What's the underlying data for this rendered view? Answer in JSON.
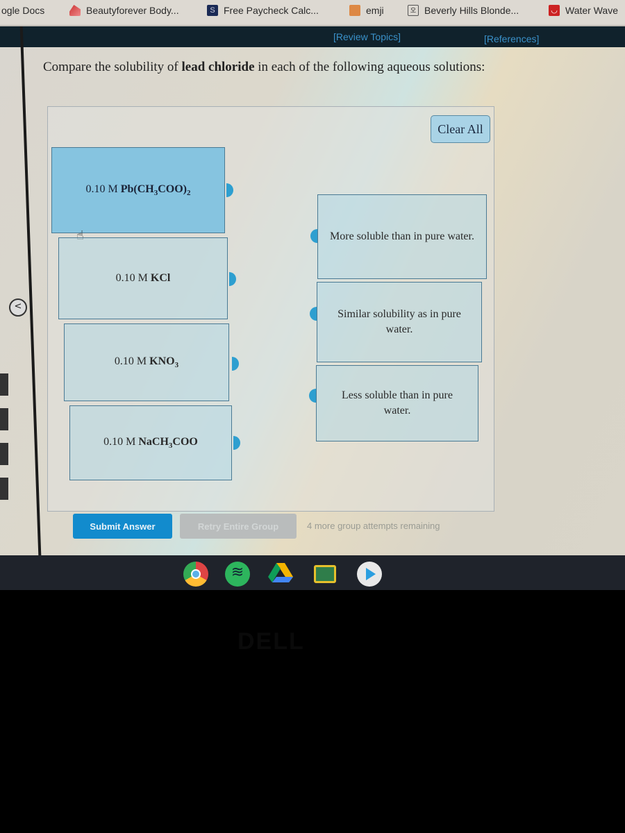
{
  "bookmarks": [
    {
      "label": "ogle Docs",
      "icon": "google-docs-icon"
    },
    {
      "label": "Beautyforever Body...",
      "icon": "beautyforever-icon"
    },
    {
      "label": "Free Paycheck Calc...",
      "icon": "s-icon",
      "icon_glyph": "S"
    },
    {
      "label": "emji",
      "icon": "emji-icon"
    },
    {
      "label": "Beverly Hills Blonde...",
      "icon": "beverly-icon",
      "icon_glyph": "오"
    },
    {
      "label": "Water Wave",
      "icon": "water-wave-icon",
      "icon_glyph": "◡"
    }
  ],
  "topnav": {
    "review_topics": "[Review Topics]",
    "references": "[References]"
  },
  "question": {
    "prefix": "Compare the solubility of ",
    "bold": "lead chloride",
    "suffix": " in each of the following aqueous solutions:"
  },
  "clear_all_label": "Clear All",
  "solutions": [
    {
      "conc": "0.10 M ",
      "formula_parts": [
        "Pb(CH",
        "3",
        "COO)",
        "2"
      ],
      "selected": true
    },
    {
      "conc": "0.10 M ",
      "formula_parts": [
        "KCl"
      ],
      "selected": false
    },
    {
      "conc": "0.10 M ",
      "formula_parts": [
        "KNO",
        "3"
      ],
      "selected": false
    },
    {
      "conc": "0.10 M ",
      "formula_parts": [
        "NaCH",
        "3",
        "COO"
      ],
      "selected": false
    }
  ],
  "answers": [
    {
      "label": "More soluble than in pure water."
    },
    {
      "label": "Similar solubility as in pure water."
    },
    {
      "label": "Less soluble than in pure water."
    }
  ],
  "buttons": {
    "submit": "Submit Answer",
    "retry": "Retry Entire Group"
  },
  "attempts_text": "4 more group attempts remaining",
  "left_edge_glyph": "<",
  "shelf_apps": [
    "chrome",
    "spotify",
    "google-drive",
    "google-classroom",
    "google-play"
  ],
  "bezel_logo": "DELL",
  "colors": {
    "accent": "#128bcd",
    "selected_tile": "#86c4e0",
    "tab": "#2e9fd0",
    "nav_bg": "#10222c",
    "nav_link": "#3a90c8"
  }
}
